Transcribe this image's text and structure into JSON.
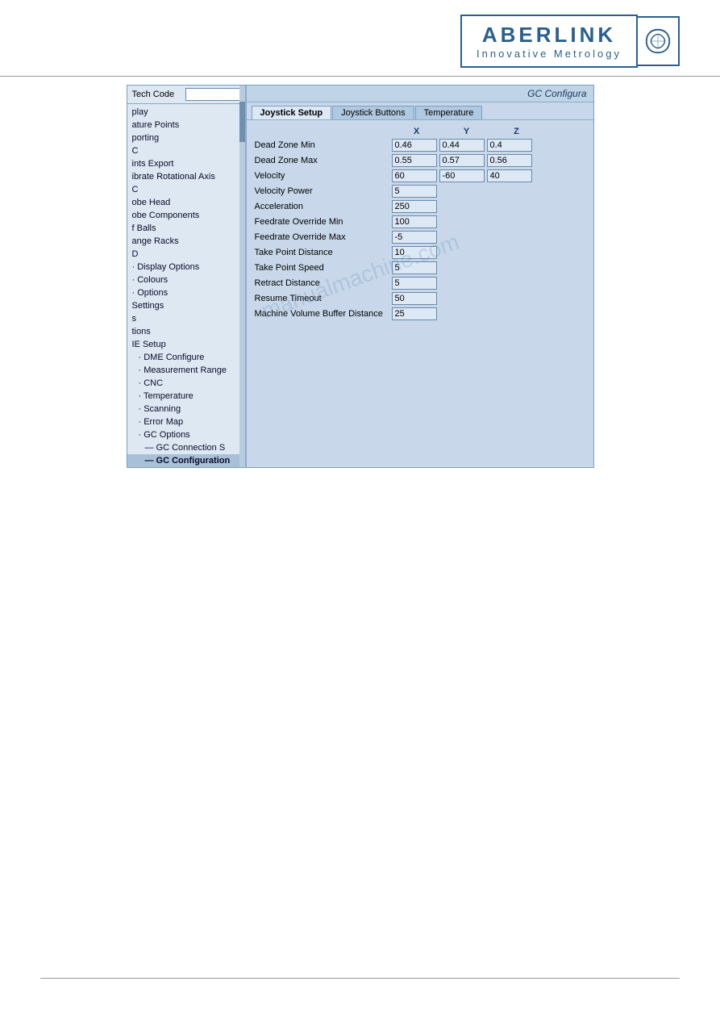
{
  "header": {
    "logo": {
      "name": "ABERLINK",
      "subtitle": "Innovative  Metrology"
    }
  },
  "sidebar": {
    "tech_code_label": "Tech Code",
    "tech_code_value": "",
    "items": [
      {
        "id": "display",
        "label": "play",
        "indent": 0
      },
      {
        "id": "feature-points",
        "label": "ature Points",
        "indent": 0
      },
      {
        "id": "porting",
        "label": "porting",
        "indent": 0
      },
      {
        "id": "c",
        "label": "C",
        "indent": 0
      },
      {
        "id": "points-export",
        "label": "ints Export",
        "indent": 0
      },
      {
        "id": "calibrate-rotational",
        "label": "ibrate Rotational Axis",
        "indent": 0
      },
      {
        "id": "c2",
        "label": "C",
        "indent": 0
      },
      {
        "id": "probe-head",
        "label": "obe Head",
        "indent": 0
      },
      {
        "id": "probe-components",
        "label": "obe Components",
        "indent": 0
      },
      {
        "id": "f-balls",
        "label": "f Balls",
        "indent": 0
      },
      {
        "id": "ange-racks",
        "label": "ange Racks",
        "indent": 0
      },
      {
        "id": "d",
        "label": "D",
        "indent": 0
      },
      {
        "id": "display-options",
        "label": "· Display Options",
        "indent": 0
      },
      {
        "id": "colours",
        "label": "· Colours",
        "indent": 0
      },
      {
        "id": "options",
        "label": "· Options",
        "indent": 0
      },
      {
        "id": "settings",
        "label": "Settings",
        "indent": 0
      },
      {
        "id": "s",
        "label": "s",
        "indent": 0
      },
      {
        "id": "tions",
        "label": "tions",
        "indent": 0
      },
      {
        "id": "ie-setup",
        "label": "IE Setup",
        "indent": 0
      },
      {
        "id": "dme-configure",
        "label": "· DME Configure",
        "indent": 1
      },
      {
        "id": "measurement-range",
        "label": "· Measurement Range",
        "indent": 1
      },
      {
        "id": "cnc",
        "label": "· CNC",
        "indent": 1
      },
      {
        "id": "temperature",
        "label": "· Temperature",
        "indent": 1
      },
      {
        "id": "scanning",
        "label": "· Scanning",
        "indent": 1
      },
      {
        "id": "error-map",
        "label": "· Error Map",
        "indent": 1
      },
      {
        "id": "gc-options",
        "label": "· GC Options",
        "indent": 1
      },
      {
        "id": "gc-connection",
        "label": "— GC Connection S",
        "indent": 2
      },
      {
        "id": "gc-configuration",
        "label": "— GC Configuration",
        "indent": 2,
        "selected": true
      }
    ]
  },
  "config": {
    "title": "GC Configura",
    "tabs": [
      {
        "id": "joystick-setup",
        "label": "Joystick Setup",
        "active": true
      },
      {
        "id": "joystick-buttons",
        "label": "Joystick Buttons",
        "active": false
      },
      {
        "id": "temperature",
        "label": "Temperature",
        "active": false
      }
    ],
    "axis_headers": [
      "X",
      "Y",
      "Z"
    ],
    "fields": [
      {
        "label": "Dead Zone Min",
        "has_xyz": true,
        "x": "0.46",
        "y": "0.44",
        "z": "0.4",
        "single": null
      },
      {
        "label": "Dead Zone Max",
        "has_xyz": true,
        "x": "0.55",
        "y": "0.57",
        "z": "0.56",
        "single": null
      },
      {
        "label": "Velocity",
        "has_xyz": true,
        "x": "60",
        "y": "-60",
        "z": "40",
        "single": null
      },
      {
        "label": "Velocity Power",
        "has_xyz": false,
        "x": null,
        "y": null,
        "z": null,
        "single": "5"
      },
      {
        "label": "Acceleration",
        "has_xyz": false,
        "x": null,
        "y": null,
        "z": null,
        "single": "250"
      },
      {
        "label": "Feedrate Override Min",
        "has_xyz": false,
        "x": null,
        "y": null,
        "z": null,
        "single": "100"
      },
      {
        "label": "Feedrate Override Max",
        "has_xyz": false,
        "x": null,
        "y": null,
        "z": null,
        "single": "-5"
      },
      {
        "label": "Take Point Distance",
        "has_xyz": false,
        "x": null,
        "y": null,
        "z": null,
        "single": "10"
      },
      {
        "label": "Take Point Speed",
        "has_xyz": false,
        "x": null,
        "y": null,
        "z": null,
        "single": "5"
      },
      {
        "label": "Retract Distance",
        "has_xyz": false,
        "x": null,
        "y": null,
        "z": null,
        "single": "5"
      },
      {
        "label": "Resume Timeout",
        "has_xyz": false,
        "x": null,
        "y": null,
        "z": null,
        "single": "50"
      },
      {
        "label": "Machine Volume Buffer Distance",
        "has_xyz": false,
        "x": null,
        "y": null,
        "z": null,
        "single": "25"
      }
    ]
  },
  "watermark": "manualmachine.com"
}
